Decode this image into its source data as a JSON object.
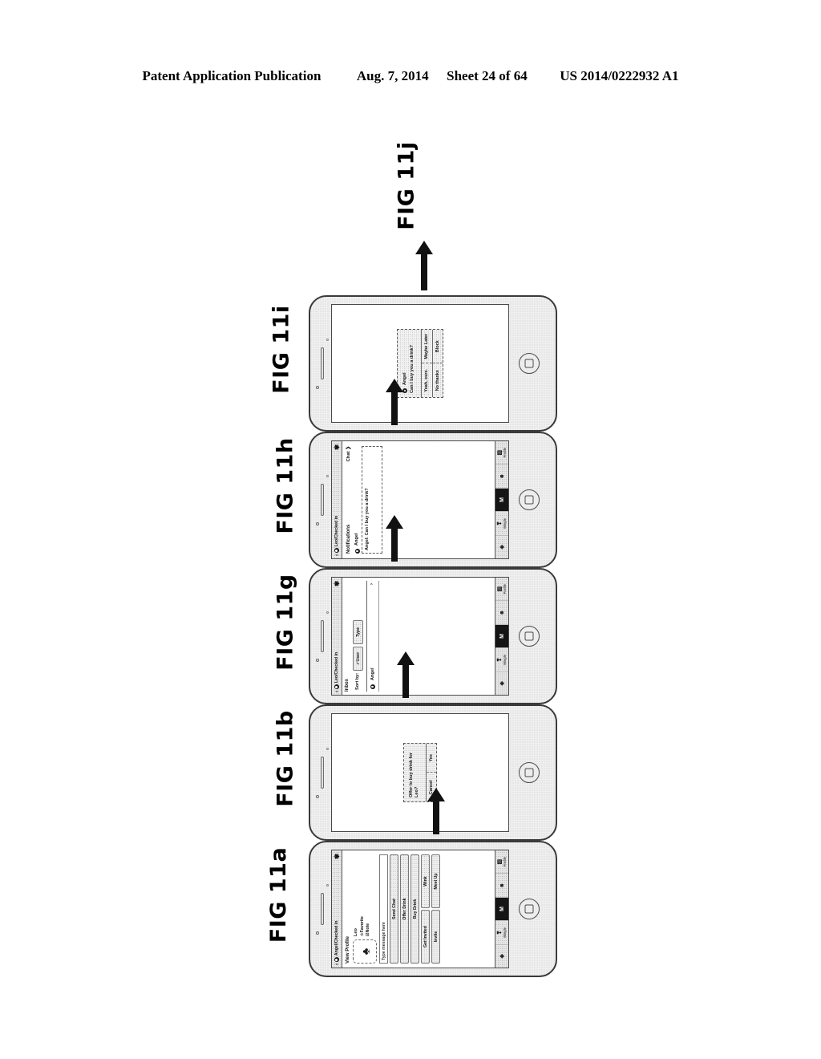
{
  "publication_header": {
    "left": "Patent Application Publication",
    "date": "Aug. 7, 2014",
    "sheet": "Sheet 24 of 64",
    "number": "US 2014/0222932 A1"
  },
  "figures": [
    {
      "id": "fig-11a",
      "label": "FIG 11a",
      "screen": {
        "navbar": {
          "back": "‹",
          "title": "Angel/Checked in",
          "settings_icon": "gear-icon"
        },
        "section_title": "View Profile",
        "profile": {
          "avatar_icon": "person-silhouette-icon",
          "name": "Leo",
          "favorite": "Favorite",
          "favorite_icon": "star-icon",
          "note": "Note",
          "note_icon": "note-icon"
        },
        "message_input_placeholder": "Type message here",
        "buttons": [
          "Send Chat",
          "Offer Drink",
          "Buy Drink"
        ],
        "button_rows": [
          [
            "Get Invited",
            "Wink"
          ],
          [
            "Invite",
            "Meet Up"
          ]
        ],
        "tabbar": [
          {
            "label": "",
            "icon": "location-icon",
            "active": false
          },
          {
            "label": "Mingle",
            "icon": "people-icon",
            "active": false
          },
          {
            "label": "",
            "icon": "M-logo-icon",
            "active": true
          },
          {
            "label": "",
            "icon": "drink-icon",
            "active": false
          },
          {
            "label": "Profile",
            "icon": "person-icon",
            "active": false
          }
        ]
      }
    },
    {
      "id": "fig-11b",
      "label": "FIG 11b",
      "dialog": {
        "message": "Offer to buy drink for Leo?",
        "buttons": [
          "Cancel",
          "Yes"
        ]
      }
    },
    {
      "id": "fig-11g",
      "label": "FIG 11g",
      "screen": {
        "navbar": {
          "back": "‹",
          "title": "Leo/Checked in",
          "settings_icon": "gear-icon"
        },
        "section_title": "Inbox",
        "sort_label": "Sort by:",
        "sort_options": [
          {
            "label": "User",
            "selected": true,
            "check": "✓"
          },
          {
            "label": "Type",
            "selected": false,
            "check": ""
          }
        ],
        "rows": [
          {
            "name": "Angel",
            "chevron": "›"
          }
        ],
        "tabbar": [
          {
            "label": "",
            "icon": "location-icon",
            "active": false
          },
          {
            "label": "Mingle",
            "icon": "people-icon",
            "active": false
          },
          {
            "label": "",
            "icon": "M-logo-icon",
            "active": true
          },
          {
            "label": "",
            "icon": "drink-icon",
            "active": false
          },
          {
            "label": "Profile",
            "icon": "person-icon",
            "active": false
          }
        ]
      }
    },
    {
      "id": "fig-11h",
      "label": "FIG 11h",
      "screen": {
        "navbar": {
          "back": "‹",
          "title": "Leo/Checked in",
          "settings_icon": "gear-icon"
        },
        "section_title": "Notifications",
        "chat_link": "Chat ❯",
        "from": "Angel",
        "bubble": "Angel: Can I buy you a drink?",
        "tabbar": [
          {
            "label": "",
            "icon": "location-icon",
            "active": false
          },
          {
            "label": "Mingle",
            "icon": "people-icon",
            "active": false
          },
          {
            "label": "",
            "icon": "M-logo-icon",
            "active": true
          },
          {
            "label": "",
            "icon": "drink-icon",
            "active": false
          },
          {
            "label": "Profile",
            "icon": "person-icon",
            "active": false
          }
        ]
      }
    },
    {
      "id": "fig-11i",
      "label": "FIG 11i",
      "dialog": {
        "from": "Angel",
        "message": "Can I buy you a drink?",
        "buttons": [
          "Yeah, sure.",
          "Maybe Later"
        ],
        "buttons_row2": [
          "No thanks",
          "Block"
        ]
      }
    }
  ],
  "next_figure_label": "FIG 11j",
  "flow": {
    "arrow_count": 5,
    "direction": "upward"
  }
}
